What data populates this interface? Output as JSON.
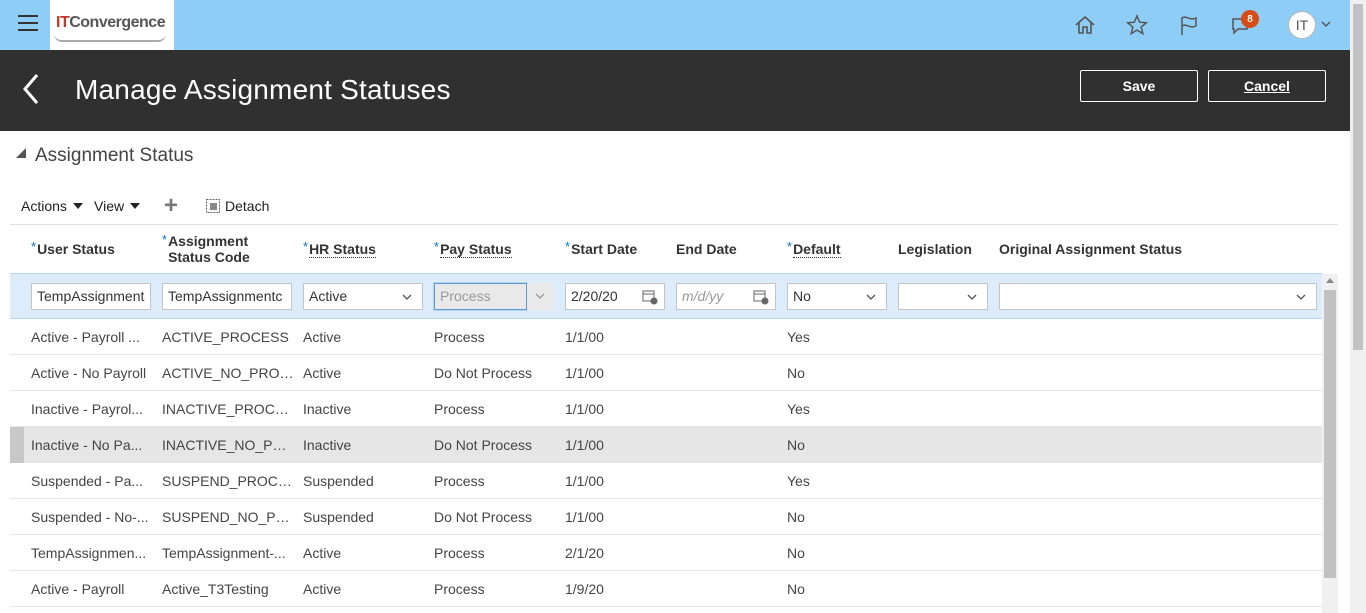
{
  "header": {
    "logo": {
      "part1": "IT",
      "part2": "Convergence"
    },
    "notifications_count": "8",
    "user_initials": "IT",
    "icons": [
      "hamburger-menu-icon",
      "home-icon",
      "star-icon",
      "flag-icon",
      "bell-icon",
      "chevron-down-icon"
    ]
  },
  "page": {
    "title": "Manage Assignment Statuses",
    "save_label": "Save",
    "cancel_label": "Cancel"
  },
  "section": {
    "title": "Assignment Status"
  },
  "toolbar": {
    "actions_label": "Actions",
    "view_label": "View",
    "add_symbol": "+",
    "detach_label": "Detach"
  },
  "table": {
    "columns": [
      {
        "label": "User Status",
        "required": true,
        "underline": false
      },
      {
        "label_line1": "Assignment",
        "label_line2": "Status Code",
        "required": true
      },
      {
        "label": "HR Status",
        "required": true,
        "underline": true
      },
      {
        "label": "Pay Status",
        "required": true,
        "underline": true
      },
      {
        "label": "Start Date",
        "required": true,
        "underline": false
      },
      {
        "label": "End Date",
        "required": false
      },
      {
        "label": "Default",
        "required": true,
        "underline": true
      },
      {
        "label": "Legislation",
        "required": false
      },
      {
        "label": "Original Assignment Status",
        "required": false
      }
    ],
    "required_marker": "*",
    "edit_row": {
      "user_status": "TempAssignment",
      "status_code": "TempAssignmentc",
      "hr_status": "Active",
      "pay_status": "Process",
      "start_date": "2/20/20",
      "end_date_placeholder": "m/d/yy",
      "default": "No",
      "legislation": "",
      "original_status": ""
    },
    "rows": [
      {
        "user_status": "Active - Payroll ...",
        "code": "ACTIVE_PROCESS",
        "hr": "Active",
        "pay": "Process",
        "start": "1/1/00",
        "end": "",
        "default": "Yes"
      },
      {
        "user_status": "Active - No Payroll",
        "code": "ACTIVE_NO_PROC...",
        "hr": "Active",
        "pay": "Do Not Process",
        "start": "1/1/00",
        "end": "",
        "default": "No"
      },
      {
        "user_status": "Inactive - Payrol...",
        "code": "INACTIVE_PROCESS",
        "hr": "Inactive",
        "pay": "Process",
        "start": "1/1/00",
        "end": "",
        "default": "Yes"
      },
      {
        "user_status": "Inactive - No Pa...",
        "code": "INACTIVE_NO_PR...",
        "hr": "Inactive",
        "pay": "Do Not Process",
        "start": "1/1/00",
        "end": "",
        "default": "No"
      },
      {
        "user_status": "Suspended - Pa...",
        "code": "SUSPEND_PROCESS",
        "hr": "Suspended",
        "pay": "Process",
        "start": "1/1/00",
        "end": "",
        "default": "Yes"
      },
      {
        "user_status": "Suspended - No-...",
        "code": "SUSPEND_NO_PR...",
        "hr": "Suspended",
        "pay": "Do Not Process",
        "start": "1/1/00",
        "end": "",
        "default": "No"
      },
      {
        "user_status": "TempAssignmen...",
        "code": "TempAssignment-...",
        "hr": "Active",
        "pay": "Process",
        "start": "2/1/20",
        "end": "",
        "default": "No"
      },
      {
        "user_status": "Active - Payroll",
        "code": "Active_T3Testing",
        "hr": "Active",
        "pay": "Process",
        "start": "1/9/20",
        "end": "",
        "default": "No"
      }
    ],
    "selected_row": 3
  },
  "colors": {
    "header_bg": "#8ecdf5",
    "title_bg": "#303030",
    "edit_row_bg": "#dcecfa",
    "required_marker": "#0572ce",
    "badge": "#d84c16"
  }
}
